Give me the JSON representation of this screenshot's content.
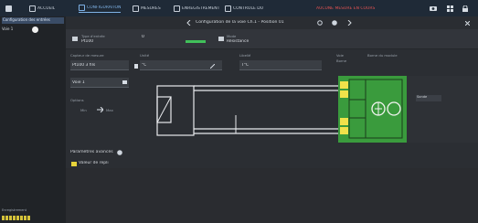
{
  "topbar": {
    "tabs": [
      {
        "label": "ACCUEIL",
        "icon": "home-icon",
        "active": false
      },
      {
        "label": "CONFIGURATION",
        "icon": "config-icon",
        "active": true
      },
      {
        "label": "MESURES",
        "icon": "measure-icon",
        "active": false
      },
      {
        "label": "ENREGISTREMENT",
        "icon": "record-icon",
        "active": false
      },
      {
        "label": "CONTRÔLE DU",
        "icon": "control-icon",
        "active": false
      }
    ],
    "status": "AUCUNE MESURE EN COURS",
    "status_color": "#e05252"
  },
  "left_panel": {
    "header": "Configuration des entrées",
    "channel_label": "Voie 1",
    "footer_label": "Enregistrement"
  },
  "toolbar": {
    "title": "Configuration de la voie Ch.1 - Position 01"
  },
  "config_row": {
    "type_label": "Type d'entrée",
    "type_value": "Pt100",
    "range_value": "0",
    "status_color": "#41c05a",
    "mode_label": "Mode",
    "mode_value": "Résistance"
  },
  "form": {
    "sensor_label": "Capteur de mesure",
    "sensor_value": "Pt100 3 fils",
    "unit_label": "Unité",
    "unit_value": "°C",
    "label_field": "Libellé",
    "label_value": "T°C",
    "cable_label": "Câblage",
    "cable_value": "Voie 1",
    "options_label": "Options",
    "options_left": "Min",
    "options_right": "Max",
    "wiring_label": "Borne",
    "wiring_value": "Borne du module",
    "right_label": "Voie",
    "badge_text": "Sonde"
  },
  "lower": {
    "section_title": "Paramètres avancés",
    "link_label": "Valeur de repli"
  }
}
